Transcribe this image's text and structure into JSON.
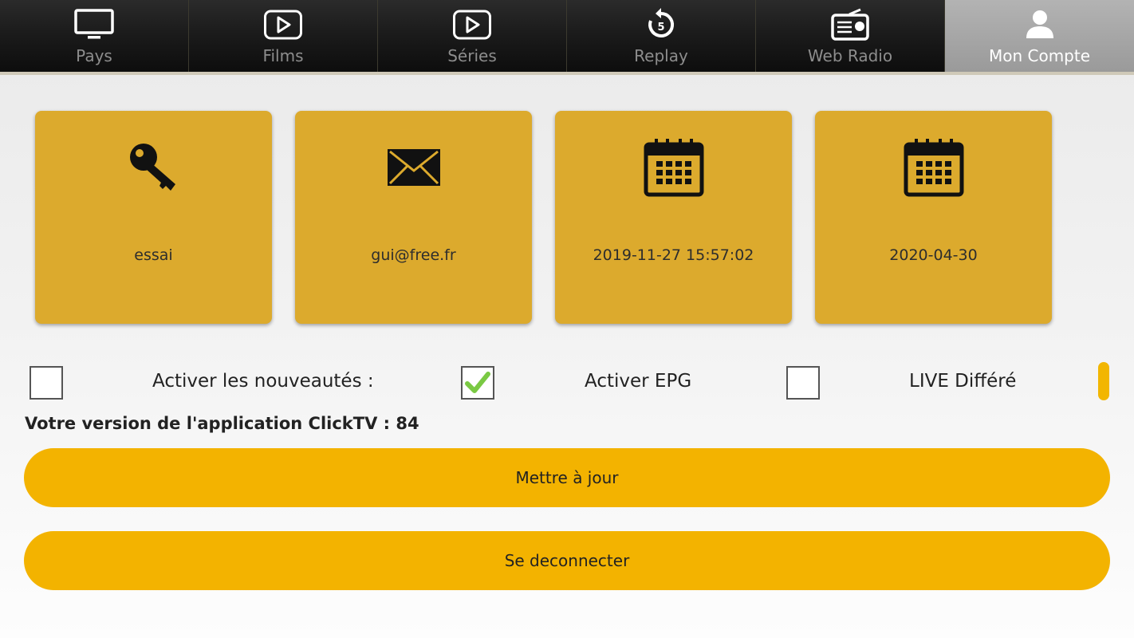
{
  "nav": {
    "tabs": [
      {
        "label": "Pays",
        "icon": "tv-icon"
      },
      {
        "label": "Films",
        "icon": "play-icon"
      },
      {
        "label": "Séries",
        "icon": "play-icon"
      },
      {
        "label": "Replay",
        "icon": "replay-icon",
        "badge": "5"
      },
      {
        "label": "Web Radio",
        "icon": "radio-icon"
      },
      {
        "label": "Mon Compte",
        "icon": "user-icon",
        "active": true
      }
    ]
  },
  "account": {
    "username": "essai",
    "email": "gui@free.fr",
    "created": "2019-11-27 15:57:02",
    "expires": "2020-04-30"
  },
  "options": {
    "new_releases_label": "Activer les nouveautés :",
    "new_releases_checked": false,
    "epg_label": "Activer EPG",
    "epg_checked": true,
    "live_label": "LIVE Différé",
    "live_checked": false
  },
  "version_text": "Votre version de l'application ClickTV : 84",
  "buttons": {
    "update": "Mettre à jour",
    "logout": "Se deconnecter"
  },
  "colors": {
    "card": "#dcaa2d",
    "button": "#f3b300",
    "check": "#7ac943"
  }
}
